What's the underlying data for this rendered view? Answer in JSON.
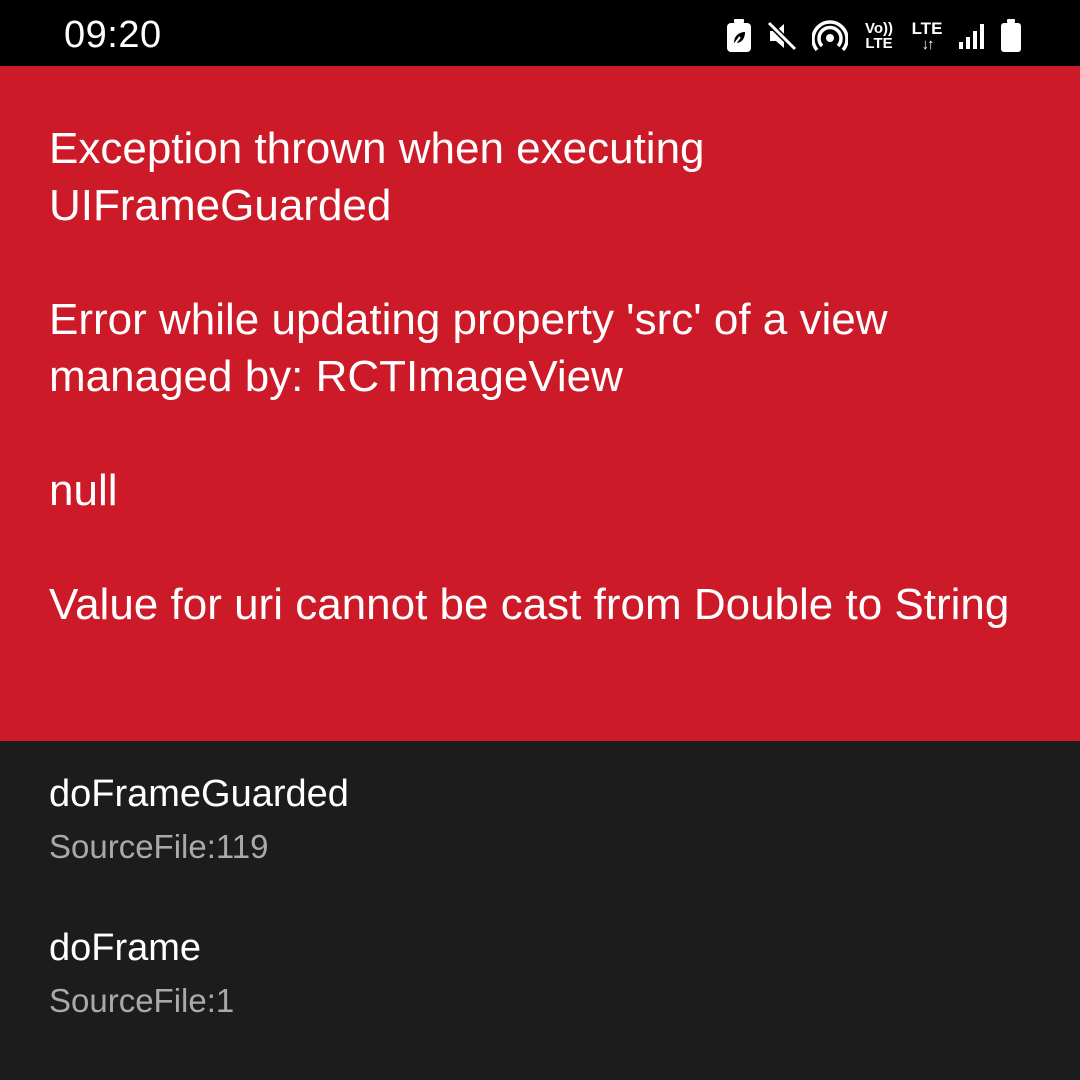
{
  "status_bar": {
    "time": "09:20",
    "icons": [
      "battery-saver-icon",
      "mute-icon",
      "hotspot-icon",
      "volte-icon",
      "lte-data-icon",
      "signal-icon",
      "battery-icon"
    ],
    "volte_line1": "Vo))",
    "volte_line2": "LTE",
    "lte_label": "LTE",
    "lte_arrows": "↓↑"
  },
  "error": {
    "message": "Exception thrown when executing UIFrameGuarded\n\nError while updating property 'src' of a view managed by: RCTImageView\n\nnull\n\nValue for uri cannot be cast from Double to String",
    "background_color": "#cd1a28"
  },
  "stack": {
    "frames": [
      {
        "method": "doFrameGuarded",
        "location": "SourceFile:119"
      },
      {
        "method": "doFrame",
        "location": "SourceFile:1"
      }
    ]
  }
}
